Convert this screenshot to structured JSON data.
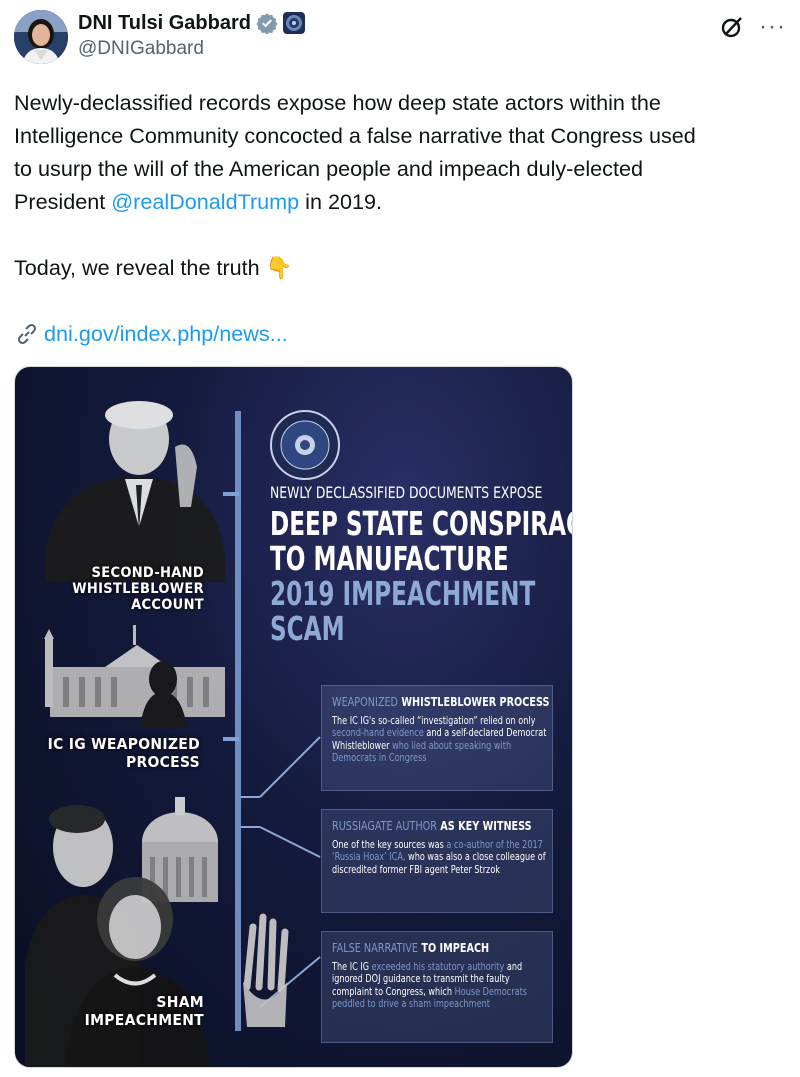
{
  "author": {
    "display_name": "DNI Tulsi Gabbard",
    "handle": "@DNIGabbard",
    "verified_icon": "verified-badge-icon",
    "affiliation_icon": "government-seal-icon"
  },
  "actions": {
    "grok_icon": "grok-icon",
    "more_icon": "more-icon",
    "more_label": "···"
  },
  "tweet": {
    "line1": "Newly-declassified records expose how deep state actors within the",
    "line2": "Intelligence Community concocted a false narrative that Congress used",
    "line3": "to usurp the will of the American people and impeach duly-elected",
    "line4_prefix": "President ",
    "mention": "@realDonaldTrump",
    "line4_suffix": " in 2019.",
    "line5": "Today, we reveal the truth",
    "emoji": "👇",
    "link": "dni.gov/index.php/news..."
  },
  "media": {
    "left_labels": {
      "label1_line1": "SECOND-HAND",
      "label1_line2": "WHISTLEBLOWER",
      "label1_line3": "ACCOUNT",
      "label2_line1": "IC IG WEAPONIZED",
      "label2_line2": "PROCESS",
      "label3_line1": "SHAM",
      "label3_line2": "IMPEACHMENT"
    },
    "headline": {
      "kicker": "NEWLY DECLASSIFIED DOCUMENTS EXPOSE",
      "line1": "DEEP STATE CONSPIRACY",
      "line2": "TO MANUFACTURE",
      "line3": "2019 IMPEACHMENT",
      "line4": "SCAM"
    },
    "box1": {
      "title_hl": "WEAPONIZED",
      "title_rest": " WHISTLEBLOWER PROCESS",
      "b1": "The IC IG's so-called “investigation” relied on only ",
      "b2": "second-hand evidence",
      "b3": " and a self-declared Democrat Whistleblower ",
      "b4": "who lied about speaking with Democrats in Congress"
    },
    "box2": {
      "title_hl": "RUSSIAGATE AUTHOR",
      "title_rest": " AS KEY WITNESS",
      "b1": "One of the key sources was ",
      "b2": "a co-author of the 2017 ‘Russia Hoax’ ICA,",
      "b3": " who was also a close colleague of discredited former FBI agent Peter Strzok"
    },
    "box3": {
      "title_hl": "FALSE NARRATIVE",
      "title_rest": " TO IMPEACH",
      "b1": "The IC IG ",
      "b2": "exceeded his statutory authority",
      "b3": " and ignored DOJ guidance to transmit the faulty complaint to Congress, which ",
      "b4": "House Democrats peddled to drive a sham impeachment"
    }
  }
}
